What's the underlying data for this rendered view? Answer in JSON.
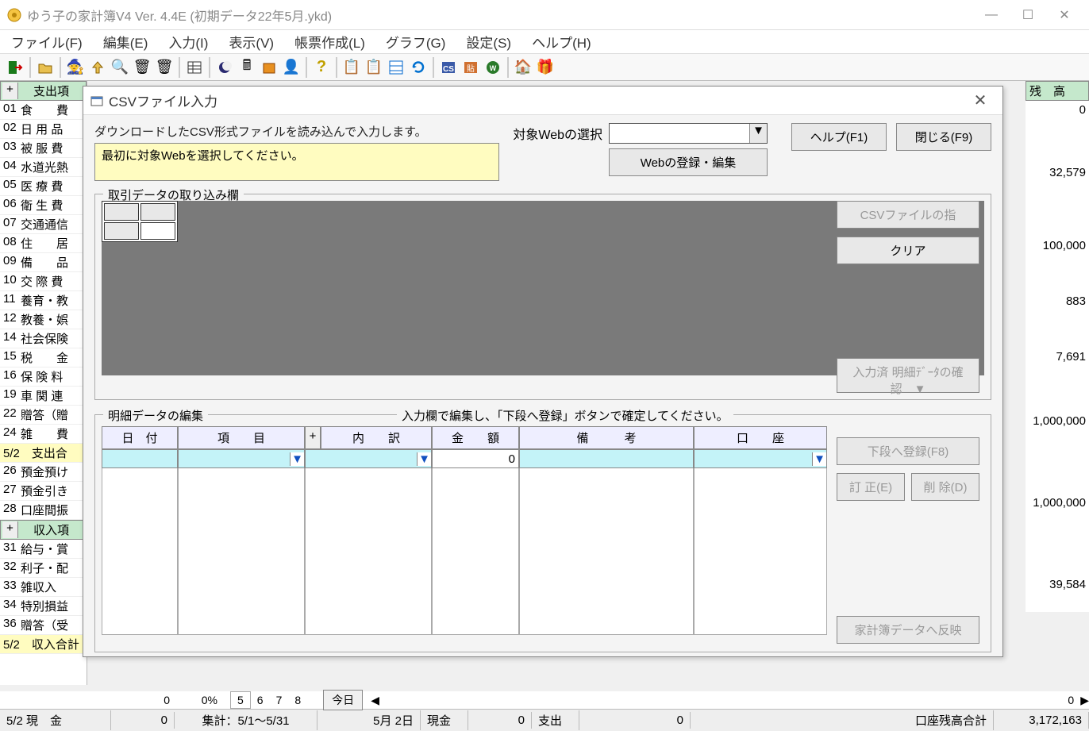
{
  "title": "ゆう子の家計簿V4  Ver. 4.4E  (初期データ22年5月.ykd)",
  "menu": [
    "ファイル(F)",
    "編集(E)",
    "入力(I)",
    "表示(V)",
    "帳票作成(L)",
    "グラフ(G)",
    "設定(S)",
    "ヘルプ(H)"
  ],
  "toolbar_icons": [
    "exit",
    "open",
    "wizard",
    "up",
    "search",
    "bin1",
    "bin2",
    "table",
    "moon",
    "calc",
    "box",
    "person",
    "help",
    "copy1",
    "copy2",
    "grid",
    "refresh",
    "cs",
    "paste",
    "web",
    "house",
    "gift"
  ],
  "cat_header": "支出項",
  "cat_header2": "収入項",
  "categories": [
    {
      "n": "01",
      "t": "食　　費"
    },
    {
      "n": "02",
      "t": "日 用 品"
    },
    {
      "n": "03",
      "t": "被 服 費"
    },
    {
      "n": "04",
      "t": "水道光熱"
    },
    {
      "n": "05",
      "t": "医 療 費"
    },
    {
      "n": "06",
      "t": "衛 生 費"
    },
    {
      "n": "07",
      "t": "交通通信"
    },
    {
      "n": "08",
      "t": "住　　居"
    },
    {
      "n": "09",
      "t": "備　　品"
    },
    {
      "n": "10",
      "t": "交 際 費"
    },
    {
      "n": "11",
      "t": "養育・教"
    },
    {
      "n": "12",
      "t": "教養・娯"
    },
    {
      "n": "14",
      "t": "社会保険"
    },
    {
      "n": "15",
      "t": "税　　金"
    },
    {
      "n": "16",
      "t": "保 険 料"
    },
    {
      "n": "19",
      "t": "車 関 連"
    },
    {
      "n": "22",
      "t": "贈答（贈"
    },
    {
      "n": "24",
      "t": "雑　　費"
    }
  ],
  "sum_row": "5/2　支出合",
  "categories2": [
    {
      "n": "26",
      "t": "預金預け"
    },
    {
      "n": "27",
      "t": "預金引き"
    },
    {
      "n": "28",
      "t": "口座間振"
    }
  ],
  "categories3": [
    {
      "n": "31",
      "t": "給与・賞"
    },
    {
      "n": "32",
      "t": "利子・配"
    },
    {
      "n": "33",
      "t": "雑収入"
    },
    {
      "n": "34",
      "t": "特別損益"
    },
    {
      "n": "36",
      "t": "贈答（受"
    }
  ],
  "income_sum": "5/2　収入合計",
  "income_vals": {
    "a": "0",
    "b": "0%"
  },
  "right_header": "残　高",
  "right_vals": [
    "0",
    "",
    "",
    "32,579",
    "",
    "",
    "100,000",
    "",
    "883",
    "",
    "7,691",
    "",
    "1,000,000",
    "",
    "",
    "1,000,000",
    "",
    "",
    "39,584"
  ],
  "dialog": {
    "title": "CSVファイル入力",
    "desc": "ダウンロードしたCSV形式ファイルを読み込んで入力します。",
    "hint": "最初に対象Webを選択してください。",
    "web_label": "対象Webの選択",
    "web_reg_btn": "Webの登録・編集",
    "help_btn": "ヘルプ(F1)",
    "close_btn": "閉じる(F9)",
    "group1": "取引データの取り込み欄",
    "csv_btn": "CSVファイルの指",
    "clear_btn": "クリア",
    "confirm_btn": "入力済 明細ﾃﾞｰﾀの確認　▼",
    "group2": "明細データの編集",
    "group2b": "入力欄で編集し、「下段へ登録」ボタンで確定してください。",
    "cols": {
      "date": "日　付",
      "item": "項　　目",
      "detail": "内　　訳",
      "amount": "金　　額",
      "memo": "備　　　考",
      "acct": "口　　座"
    },
    "amount_val": "0",
    "reg_btn": "下段へ登録(F8)",
    "edit_btn": "訂 正(E)",
    "del_btn": "削 除(D)",
    "reflect_btn": "家計簿データへ反映"
  },
  "bottombar": {
    "prev0": "0",
    "prev0p": "0%",
    "days": [
      "5",
      "6",
      "7",
      "8"
    ],
    "today": "今日",
    "status_date": "5/2 現　金",
    "status_val1": "0",
    "aggregate": "集計：5/1～5/31",
    "mid_date": "5月 2日",
    "cash": "現金",
    "cash_val": "0",
    "expense": "支出",
    "expense_val": "0",
    "balance_label": "口座残高合計",
    "balance_val": "3,172,163"
  }
}
